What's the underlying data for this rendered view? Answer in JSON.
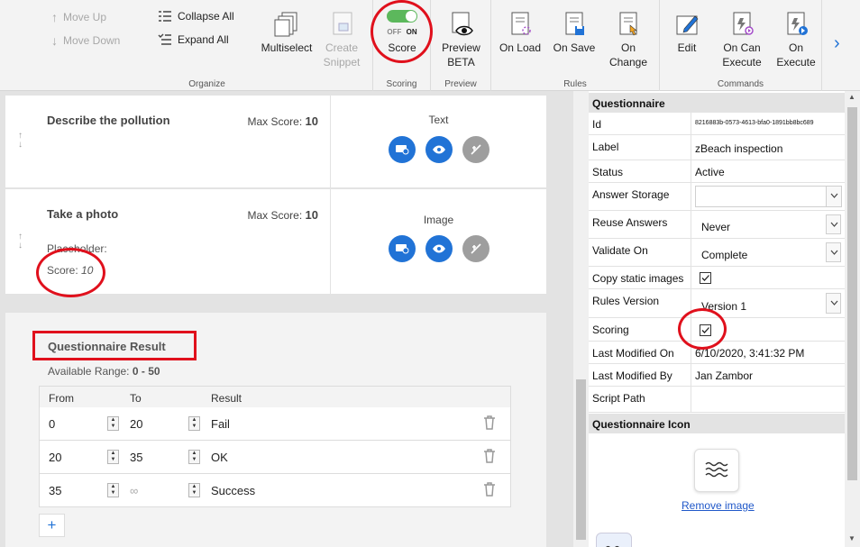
{
  "ribbon": {
    "organize": {
      "label": "Organize",
      "move_up": "Move Up",
      "move_down": "Move Down",
      "collapse_all": "Collapse All",
      "expand_all": "Expand All",
      "multiselect": "Multiselect",
      "create_snippet_1": "Create",
      "create_snippet_2": "Snippet"
    },
    "scoring": {
      "label": "Scoring",
      "toggle_off": "OFF",
      "toggle_on": "ON",
      "score": "Score",
      "enabled": true
    },
    "preview": {
      "label": "Preview",
      "preview_1": "Preview",
      "preview_2": "BETA"
    },
    "rules": {
      "label": "Rules",
      "on_load": "On Load",
      "on_save": "On Save",
      "on_change_1": "On",
      "on_change_2": "Change"
    },
    "commands": {
      "label": "Commands",
      "edit": "Edit",
      "on_can_execute_1": "On Can",
      "on_can_execute_2": "Execute",
      "on_execute_1": "On",
      "on_execute_2": "Execute"
    }
  },
  "questions": [
    {
      "title": "Describe the pollution",
      "max_score_label": "Max Score:",
      "max_score": "10",
      "type": "Text"
    },
    {
      "title": "Take a photo",
      "max_score_label": "Max Score:",
      "max_score": "10",
      "type": "Image",
      "placeholder_label": "Placeholder:",
      "score_label": "Score:",
      "score_value": "10"
    }
  ],
  "result": {
    "title": "Questionnaire Result",
    "range_label": "Available Range:",
    "range_value": "0 - 50",
    "columns": [
      "From",
      "To",
      "Result"
    ],
    "rows": [
      {
        "from": "0",
        "to": "20",
        "result": "Fail"
      },
      {
        "from": "20",
        "to": "35",
        "result": "OK"
      },
      {
        "from": "35",
        "to": "∞",
        "result": "Success"
      }
    ],
    "add": "+"
  },
  "props": {
    "section_questionnaire": "Questionnaire",
    "id_label": "Id",
    "id_value": "8216883b-0573-4613-bfa0-1891bb8bc689",
    "label_label": "Label",
    "label_value": "zBeach inspection",
    "status_label": "Status",
    "status_value": "Active",
    "answer_storage_label": "Answer Storage",
    "answer_storage_value": "",
    "reuse_answers_label": "Reuse Answers",
    "reuse_answers_value": "Never",
    "validate_on_label": "Validate On",
    "validate_on_value": "Complete",
    "copy_static_label": "Copy static images",
    "copy_static_checked": true,
    "rules_version_label": "Rules Version",
    "rules_version_value": "Version 1",
    "scoring_label": "Scoring",
    "scoring_checked": true,
    "last_modified_on_label": "Last Modified On",
    "last_modified_on_value": "6/10/2020, 3:41:32 PM",
    "last_modified_by_label": "Last Modified By",
    "last_modified_by_value": "Jan Zambor",
    "script_path_label": "Script Path",
    "script_path_value": "",
    "section_icon": "Questionnaire Icon",
    "remove_image": "Remove image"
  },
  "colors": {
    "accent_blue": "#2173d6",
    "highlight_red": "#e0101c",
    "toggle_green": "#5cb85c"
  }
}
